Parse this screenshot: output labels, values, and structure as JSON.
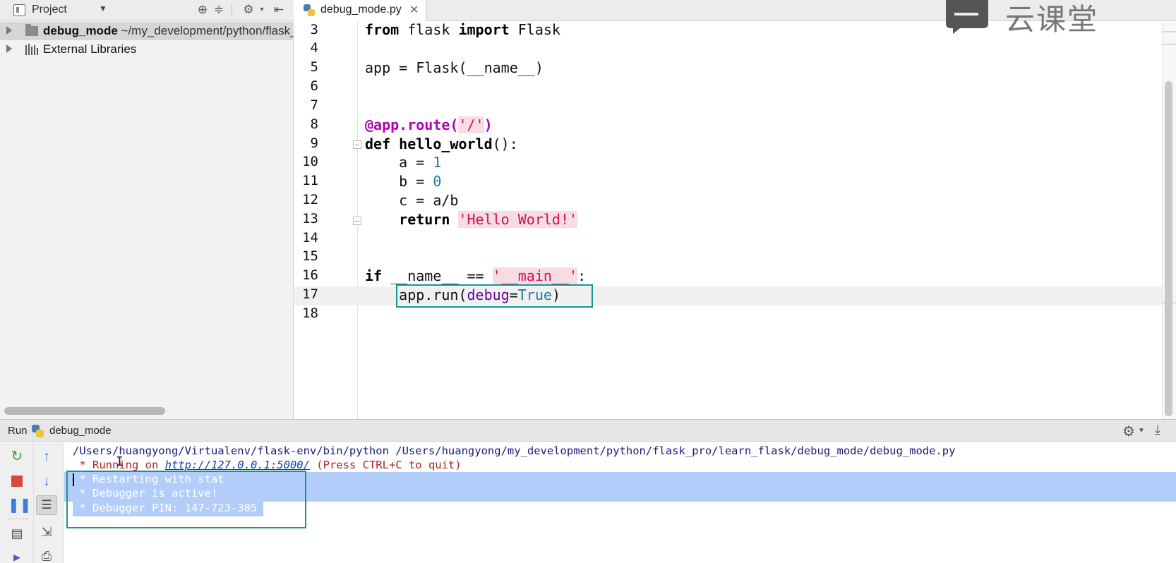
{
  "project_panel": {
    "title": "Project",
    "tree": [
      {
        "name": "debug_mode",
        "path": "~/my_development/python/flask_pro/learn_flask/debug_mode"
      },
      {
        "name": "External Libraries"
      }
    ]
  },
  "editor": {
    "active_tab": "debug_mode.py",
    "lines": [
      {
        "num": "3"
      },
      {
        "num": "4"
      },
      {
        "num": "5"
      },
      {
        "num": "6"
      },
      {
        "num": "7"
      },
      {
        "num": "8"
      },
      {
        "num": "9"
      },
      {
        "num": "10"
      },
      {
        "num": "11"
      },
      {
        "num": "12"
      },
      {
        "num": "13"
      },
      {
        "num": "14"
      },
      {
        "num": "15"
      },
      {
        "num": "16"
      },
      {
        "num": "17"
      },
      {
        "num": "18"
      }
    ],
    "code": {
      "l3_from": "from",
      "l3_module": " flask ",
      "l3_import": "import",
      "l3_name": " Flask",
      "l5": "app = Flask(__name__)",
      "l8_dec": "@app.route(",
      "l8_str": "'/'",
      "l8_close": ")",
      "l9_def": "def",
      "l9_fn": " hello_world",
      "l9_rest": "():",
      "l10_var": "    a = ",
      "l10_val": "1",
      "l11_var": "    b = ",
      "l11_val": "0",
      "l12": "    c = a/b",
      "l13_ret": "    return ",
      "l13_str": "'Hello World!'",
      "l16_if": "if",
      "l16_mid": " __name__ == ",
      "l16_str": "'__main__'",
      "l16_colon": ":",
      "l17_pre": "    app.run(",
      "l17_param": "debug",
      "l17_eq": "=",
      "l17_const": "True",
      "l17_close": ")"
    }
  },
  "watermark": {
    "text": "云课堂"
  },
  "run_panel": {
    "title": "Run",
    "config_name": "debug_mode",
    "console": {
      "line1": "/Users/huangyong/Virtualenv/flask-env/bin/python /Users/huangyong/my_development/python/flask_pro/learn_flask/debug_mode/debug_mode.py",
      "line2_prefix": " * Running on ",
      "line2_link": "http://127.0.0.1:5000/",
      "line2_suffix": " (Press CTRL+C to quit)",
      "line3": " * Restarting with stat",
      "line4": " * Debugger is active!",
      "line5": " * Debugger PIN: 147-723-305"
    }
  },
  "colors": {
    "highlight_box": "#16958f",
    "selection": "#b3cdfb",
    "string_bg": "#f7dde3"
  }
}
